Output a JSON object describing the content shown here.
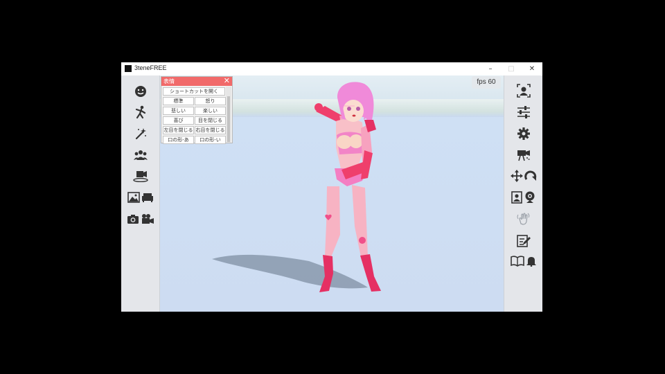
{
  "window": {
    "title": "3teneFREE",
    "controls": {
      "minimize": "–",
      "maximize": "□",
      "close": "✕"
    }
  },
  "viewport": {
    "fps_label": "fps  60"
  },
  "expression_panel": {
    "title": "表情",
    "close_label": "✕",
    "buttons": {
      "shortcut": "ショートカットを開く",
      "neutral": "標準",
      "angry": "怒り",
      "sad": "悲しい",
      "fun": "楽しい",
      "joy": "喜び",
      "close_eyes": "目を閉じる",
      "close_left_eye": "左目を閉じる",
      "close_right_eye": "右目を閉じる",
      "mouth_a": "口の形-あ",
      "mouth_i": "口の形-い"
    }
  },
  "left_toolbar": {
    "items": [
      "face-icon",
      "pose-icon",
      "magic-wand-icon",
      "group-icon",
      "stage-camera-icon",
      "background-image-icon",
      "furniture-icon",
      "photo-camera-icon",
      "video-camera-icon"
    ]
  },
  "right_toolbar": {
    "items": [
      "face-tracking-icon",
      "sliders-icon",
      "gear-icon",
      "camera-settings-icon",
      "move-icon",
      "rotate-icon",
      "profile-card-icon",
      "webcam-icon",
      "hand-tracking-icon",
      "edit-note-icon",
      "book-icon",
      "bell-icon"
    ]
  },
  "colors": {
    "panel_header": "#f16a6a",
    "sidebar": "#e4e6ea",
    "floor": "#cddcf2",
    "character_pink": "#f45ca8"
  }
}
